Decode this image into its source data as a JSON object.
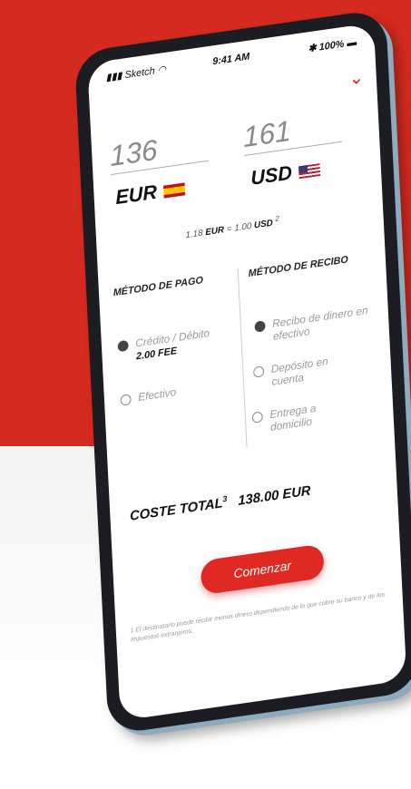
{
  "status": {
    "carrier": "Sketch",
    "time": "9:41 AM",
    "battery": "100%"
  },
  "icons": {
    "dropdown": "chevron-down-icon",
    "signal": "signal-icon",
    "wifi": "wifi-icon",
    "bluetooth": "bluetooth-icon",
    "battery": "battery-icon"
  },
  "converter": {
    "send_amount": "136",
    "send_currency": "EUR",
    "receive_amount": "161",
    "receive_currency": "USD",
    "rate_prefix": "1.18",
    "rate_from": "EUR",
    "rate_eq": "= 1.00",
    "rate_to": "USD",
    "rate_note": "2"
  },
  "payment": {
    "title": "MÉTODO DE PAGO",
    "options": [
      {
        "label": "Crédito / Débito",
        "fee": "2.00 FEE",
        "selected": true
      },
      {
        "label": "Efectivo",
        "selected": false
      }
    ]
  },
  "receive": {
    "title": "MÉTODO DE RECIBO",
    "options": [
      {
        "label": "Recibo de dinero en efectivo",
        "selected": true
      },
      {
        "label": "Depósito en cuenta",
        "selected": false
      },
      {
        "label": "Entrega a domicilio",
        "selected": false
      }
    ]
  },
  "total": {
    "label": "COSTE TOTAL",
    "note": "3",
    "amount": "138.00 EUR"
  },
  "cta": {
    "label": "Comenzar"
  },
  "footnote": "1 El destinatario puede recibir menos dinero dependiendo de lo que cobre su banco y de los impuestos extranjeros.",
  "colors": {
    "brand": "#d42a1f",
    "button": "#e02922"
  }
}
